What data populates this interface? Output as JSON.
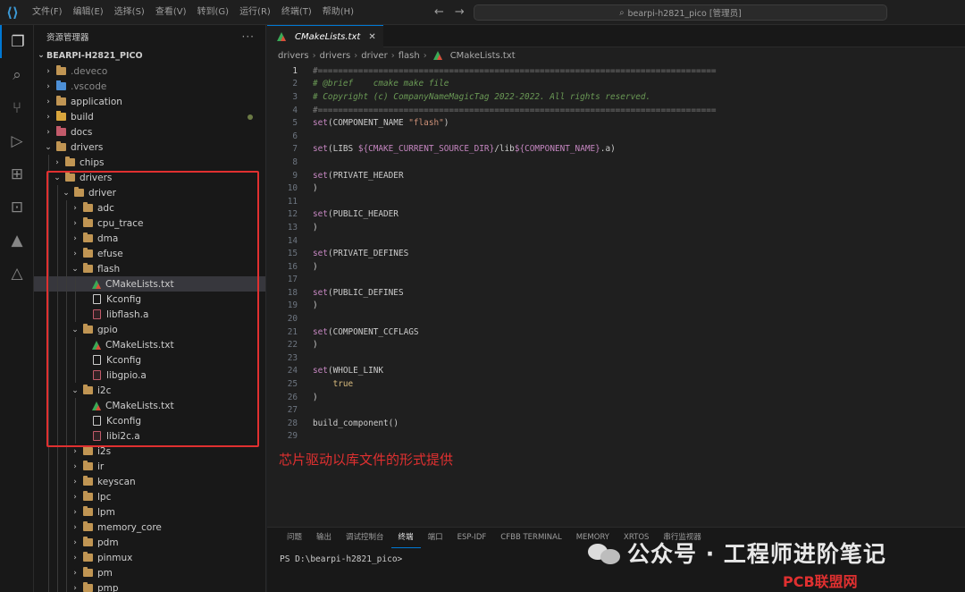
{
  "titlebar": {
    "menu": [
      "文件(F)",
      "编辑(E)",
      "选择(S)",
      "查看(V)",
      "转到(G)",
      "运行(R)",
      "终端(T)",
      "帮助(H)"
    ],
    "search_text": "bearpi-h2821_pico [管理员]"
  },
  "sidebar": {
    "title": "资源管理器",
    "workspace": "BEARPI-H2821_PICO",
    "tree": [
      {
        "label": ".deveco",
        "depth": 0,
        "type": "folder",
        "open": false,
        "dim": true
      },
      {
        "label": ".vscode",
        "depth": 0,
        "type": "folder-blue",
        "open": false,
        "dim": true
      },
      {
        "label": "application",
        "depth": 0,
        "type": "folder",
        "open": false
      },
      {
        "label": "build",
        "depth": 0,
        "type": "folder-gold",
        "open": false,
        "dot": true
      },
      {
        "label": "docs",
        "depth": 0,
        "type": "folder-red",
        "open": false
      },
      {
        "label": "drivers",
        "depth": 0,
        "type": "folder",
        "open": true
      },
      {
        "label": "chips",
        "depth": 1,
        "type": "folder",
        "open": false
      },
      {
        "label": "drivers",
        "depth": 1,
        "type": "folder",
        "open": true
      },
      {
        "label": "driver",
        "depth": 2,
        "type": "folder",
        "open": true
      },
      {
        "label": "adc",
        "depth": 3,
        "type": "folder",
        "open": false
      },
      {
        "label": "cpu_trace",
        "depth": 3,
        "type": "folder",
        "open": false
      },
      {
        "label": "dma",
        "depth": 3,
        "type": "folder",
        "open": false
      },
      {
        "label": "efuse",
        "depth": 3,
        "type": "folder",
        "open": false
      },
      {
        "label": "flash",
        "depth": 3,
        "type": "folder",
        "open": true
      },
      {
        "label": "CMakeLists.txt",
        "depth": 4,
        "type": "cmake",
        "selected": true
      },
      {
        "label": "Kconfig",
        "depth": 4,
        "type": "file"
      },
      {
        "label": "libflash.a",
        "depth": 4,
        "type": "lib"
      },
      {
        "label": "gpio",
        "depth": 3,
        "type": "folder",
        "open": true
      },
      {
        "label": "CMakeLists.txt",
        "depth": 4,
        "type": "cmake"
      },
      {
        "label": "Kconfig",
        "depth": 4,
        "type": "file"
      },
      {
        "label": "libgpio.a",
        "depth": 4,
        "type": "lib"
      },
      {
        "label": "i2c",
        "depth": 3,
        "type": "folder",
        "open": true
      },
      {
        "label": "CMakeLists.txt",
        "depth": 4,
        "type": "cmake"
      },
      {
        "label": "Kconfig",
        "depth": 4,
        "type": "file"
      },
      {
        "label": "libi2c.a",
        "depth": 4,
        "type": "lib"
      },
      {
        "label": "i2s",
        "depth": 3,
        "type": "folder",
        "open": false
      },
      {
        "label": "ir",
        "depth": 3,
        "type": "folder",
        "open": false
      },
      {
        "label": "keyscan",
        "depth": 3,
        "type": "folder",
        "open": false
      },
      {
        "label": "lpc",
        "depth": 3,
        "type": "folder",
        "open": false
      },
      {
        "label": "lpm",
        "depth": 3,
        "type": "folder",
        "open": false
      },
      {
        "label": "memory_core",
        "depth": 3,
        "type": "folder",
        "open": false
      },
      {
        "label": "pdm",
        "depth": 3,
        "type": "folder",
        "open": false
      },
      {
        "label": "pinmux",
        "depth": 3,
        "type": "folder",
        "open": false
      },
      {
        "label": "pm",
        "depth": 3,
        "type": "folder",
        "open": false
      },
      {
        "label": "pmp",
        "depth": 3,
        "type": "folder",
        "open": false
      }
    ]
  },
  "editor": {
    "tab_label": "CMakeLists.txt",
    "breadcrumb": [
      "drivers",
      "drivers",
      "driver",
      "flash",
      "CMakeLists.txt"
    ],
    "current_line": 1,
    "lines": [
      [
        {
          "t": "#===============================================================================",
          "c": "c-comment gray"
        }
      ],
      [
        {
          "t": "# @brief    cmake make file",
          "c": "c-comment"
        }
      ],
      [
        {
          "t": "# Copyright (c) CompanyNameMagicTag 2022-2022. All rights reserved.",
          "c": "c-comment"
        }
      ],
      [
        {
          "t": "#===============================================================================",
          "c": "c-comment gray"
        }
      ],
      [
        {
          "t": "set",
          "c": "c-kw"
        },
        {
          "t": "(COMPONENT_NAME ",
          "c": "c-plain"
        },
        {
          "t": "\"flash\"",
          "c": "c-str"
        },
        {
          "t": ")",
          "c": "c-plain"
        }
      ],
      [],
      [
        {
          "t": "set",
          "c": "c-kw"
        },
        {
          "t": "(LIBS ",
          "c": "c-plain"
        },
        {
          "t": "${",
          "c": "c-var"
        },
        {
          "t": "CMAKE_CURRENT_SOURCE_DIR",
          "c": "c-var"
        },
        {
          "t": "}",
          "c": "c-var"
        },
        {
          "t": "/lib",
          "c": "c-plain"
        },
        {
          "t": "${",
          "c": "c-var"
        },
        {
          "t": "COMPONENT_NAME",
          "c": "c-var"
        },
        {
          "t": "}",
          "c": "c-var"
        },
        {
          "t": ".a)",
          "c": "c-plain"
        }
      ],
      [],
      [
        {
          "t": "set",
          "c": "c-kw"
        },
        {
          "t": "(PRIVATE_HEADER",
          "c": "c-plain"
        }
      ],
      [
        {
          "t": ")",
          "c": "c-plain"
        }
      ],
      [],
      [
        {
          "t": "set",
          "c": "c-kw"
        },
        {
          "t": "(PUBLIC_HEADER",
          "c": "c-plain"
        }
      ],
      [
        {
          "t": ")",
          "c": "c-plain"
        }
      ],
      [],
      [
        {
          "t": "set",
          "c": "c-kw"
        },
        {
          "t": "(PRIVATE_DEFINES",
          "c": "c-plain"
        }
      ],
      [
        {
          "t": ")",
          "c": "c-plain"
        }
      ],
      [],
      [
        {
          "t": "set",
          "c": "c-kw"
        },
        {
          "t": "(PUBLIC_DEFINES",
          "c": "c-plain"
        }
      ],
      [
        {
          "t": ")",
          "c": "c-plain"
        }
      ],
      [],
      [
        {
          "t": "set",
          "c": "c-kw"
        },
        {
          "t": "(COMPONENT_CCFLAGS",
          "c": "c-plain"
        }
      ],
      [
        {
          "t": ")",
          "c": "c-plain"
        }
      ],
      [],
      [
        {
          "t": "set",
          "c": "c-kw"
        },
        {
          "t": "(WHOLE_LINK",
          "c": "c-plain"
        }
      ],
      [
        {
          "t": "    true",
          "c": "c-true"
        }
      ],
      [
        {
          "t": ")",
          "c": "c-plain"
        }
      ],
      [],
      [
        {
          "t": "build_component",
          "c": "c-plain"
        },
        {
          "t": "()",
          "c": "c-plain"
        }
      ],
      []
    ],
    "annotation": "芯片驱动以库文件的形式提供"
  },
  "panel": {
    "tabs": [
      "问题",
      "输出",
      "调试控制台",
      "终端",
      "端口",
      "ESP-IDF",
      "CFBB TERMINAL",
      "MEMORY",
      "XRTOS",
      "串行监视器"
    ],
    "active_tab": 3,
    "terminal_prompt": "PS D:\\bearpi-h2821_pico>"
  },
  "watermark": {
    "text": "公众号 · 工程师进阶笔记",
    "site": "PCB联盟网 (Pcbbar.com)"
  },
  "colors": {
    "accent": "#0078d4",
    "annotation": "#e03030"
  }
}
